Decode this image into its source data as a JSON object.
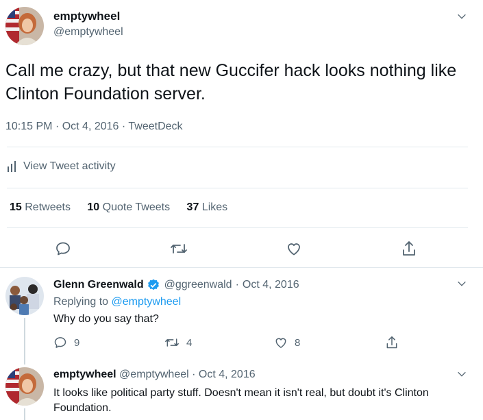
{
  "main_tweet": {
    "display_name": "emptywheel",
    "handle": "@emptywheel",
    "text": "Call me crazy, but that new Guccifer hack looks nothing like Clinton Foundation server.",
    "time": "10:15 PM",
    "date": "Oct 4, 2016",
    "source": "TweetDeck",
    "sep": "·",
    "activity_label": "View Tweet activity",
    "stats": {
      "retweets_count": "15",
      "retweets_label": "Retweets",
      "quotes_count": "10",
      "quotes_label": "Quote Tweets",
      "likes_count": "37",
      "likes_label": "Likes"
    }
  },
  "replies": [
    {
      "display_name": "Glenn Greenwald",
      "verified": true,
      "handle": "@ggreenwald",
      "sep": "·",
      "date": "Oct 4, 2016",
      "replying_prefix": "Replying to",
      "replying_to": "@emptywheel",
      "text": "Why do you say that?",
      "reply_count": "9",
      "retweet_count": "4",
      "like_count": "8"
    },
    {
      "display_name": "emptywheel",
      "handle": "@emptywheel",
      "sep": "·",
      "date": "Oct 4, 2016",
      "text": "It looks like political party stuff. Doesn't mean it isn't real, but doubt it's Clinton Foundation."
    }
  ],
  "icons": {
    "caret": "chevron-down-icon",
    "activity": "bar-chart-icon",
    "reply": "speech-bubble-icon",
    "retweet": "retweet-icon",
    "like": "heart-icon",
    "share": "share-icon",
    "verified": "verified-badge-icon"
  },
  "colors": {
    "accent": "#1d9bf0",
    "text": "#0f1419",
    "secondary": "#536471",
    "divider": "#e1e8ed"
  }
}
